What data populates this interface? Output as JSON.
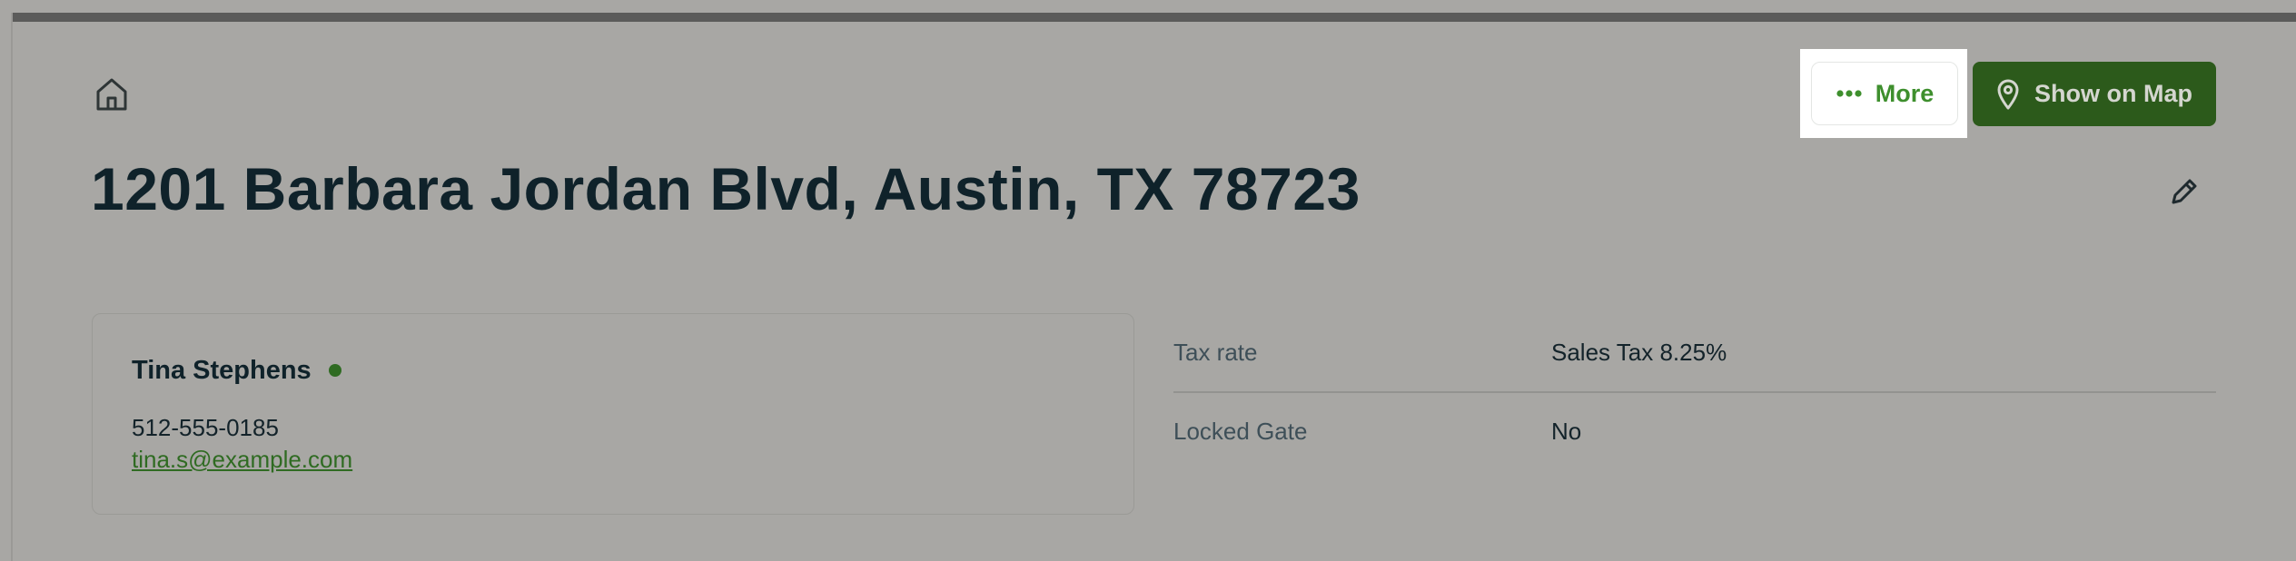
{
  "header": {
    "more_label": "More",
    "map_label": "Show on Map"
  },
  "property": {
    "address": "1201 Barbara Jordan Blvd, Austin, TX 78723"
  },
  "contact": {
    "name": "Tina Stephens",
    "phone": "512-555-0185",
    "email": "tina.s@example.com",
    "status_color": "#2f6b22"
  },
  "details": [
    {
      "label": "Tax rate",
      "value": "Sales Tax 8.25%"
    },
    {
      "label": "Locked Gate",
      "value": "No"
    }
  ],
  "icons": {
    "home": "home-icon",
    "more": "more-dots-icon",
    "map": "map-pin-icon",
    "edit": "pencil-icon"
  },
  "colors": {
    "primary_green": "#2c5a1b",
    "accent_green": "#3e8f2d",
    "heading": "#0f222a"
  }
}
